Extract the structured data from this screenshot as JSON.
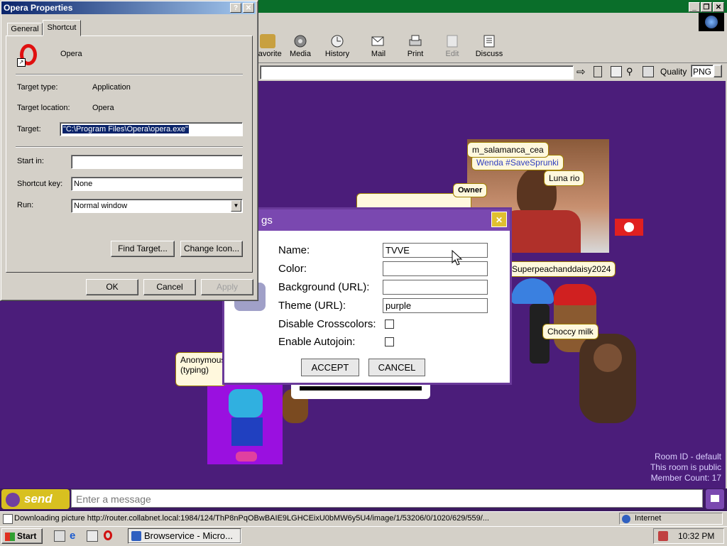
{
  "props_dialog": {
    "title": "Opera Properties",
    "tabs": [
      "General",
      "Shortcut"
    ],
    "app_name": "Opera",
    "target_type_label": "Target type:",
    "target_type_value": "Application",
    "target_location_label": "Target location:",
    "target_location_value": "Opera",
    "target_label": "Target:",
    "target_value": "\"C:\\Program Files\\Opera\\opera.exe\"",
    "start_in_label": "Start in:",
    "start_in_value": "",
    "shortcut_key_label": "Shortcut key:",
    "shortcut_key_value": "None",
    "run_label": "Run:",
    "run_value": "Normal window",
    "find_target_label": "Find Target...",
    "change_icon_label": "Change Icon...",
    "ok_label": "OK",
    "cancel_label": "Cancel",
    "apply_label": "Apply"
  },
  "ie": {
    "toolbar": [
      {
        "label": "Favorites",
        "icon": "favorites-icon"
      },
      {
        "label": "Media",
        "icon": "media-icon"
      },
      {
        "label": "History",
        "icon": "history-icon"
      },
      {
        "label": "Mail",
        "icon": "mail-icon"
      },
      {
        "label": "Print",
        "icon": "print-icon"
      },
      {
        "label": "Edit",
        "icon": "edit-icon"
      },
      {
        "label": "Discuss",
        "icon": "discuss-icon"
      }
    ],
    "quality_label": "Quality",
    "quality_value": "PNG"
  },
  "room": {
    "bubbles": [
      "m_salamanca_cea",
      "Wenda #SaveSprunki",
      "Luna rio",
      "Owner",
      "Superpeachanddaisy2024",
      "Choccy milk",
      "Anonymous (typing)"
    ],
    "room_id": "Room ID - default",
    "room_public": "This room is public",
    "member_count": "Member Count: 17",
    "send_label": "send",
    "message_placeholder": "Enter a message"
  },
  "room_dialog": {
    "title_fragment": "gs",
    "name_label": "Name:",
    "name_value": "TVVE",
    "color_label": "Color:",
    "color_value": "",
    "background_label": "Background (URL):",
    "background_value": "",
    "theme_label": "Theme (URL):",
    "theme_value": "purple",
    "disable_crosscolors_label": "Disable Crosscolors:",
    "enable_autojoin_label": "Enable Autojoin:",
    "accept_label": "ACCEPT",
    "cancel_label": "CANCEL"
  },
  "status": {
    "text": "Downloading picture http://router.collabnet.local:1984/124/ThP8nPqOBwBAIE9LGHCEixU0bMW6y5U4/image/1/53206/0/1020/629/559/...",
    "zone": "Internet"
  },
  "taskbar": {
    "start_label": "Start",
    "task_label": "Browservice - Micro...",
    "clock": "10:32 PM"
  }
}
